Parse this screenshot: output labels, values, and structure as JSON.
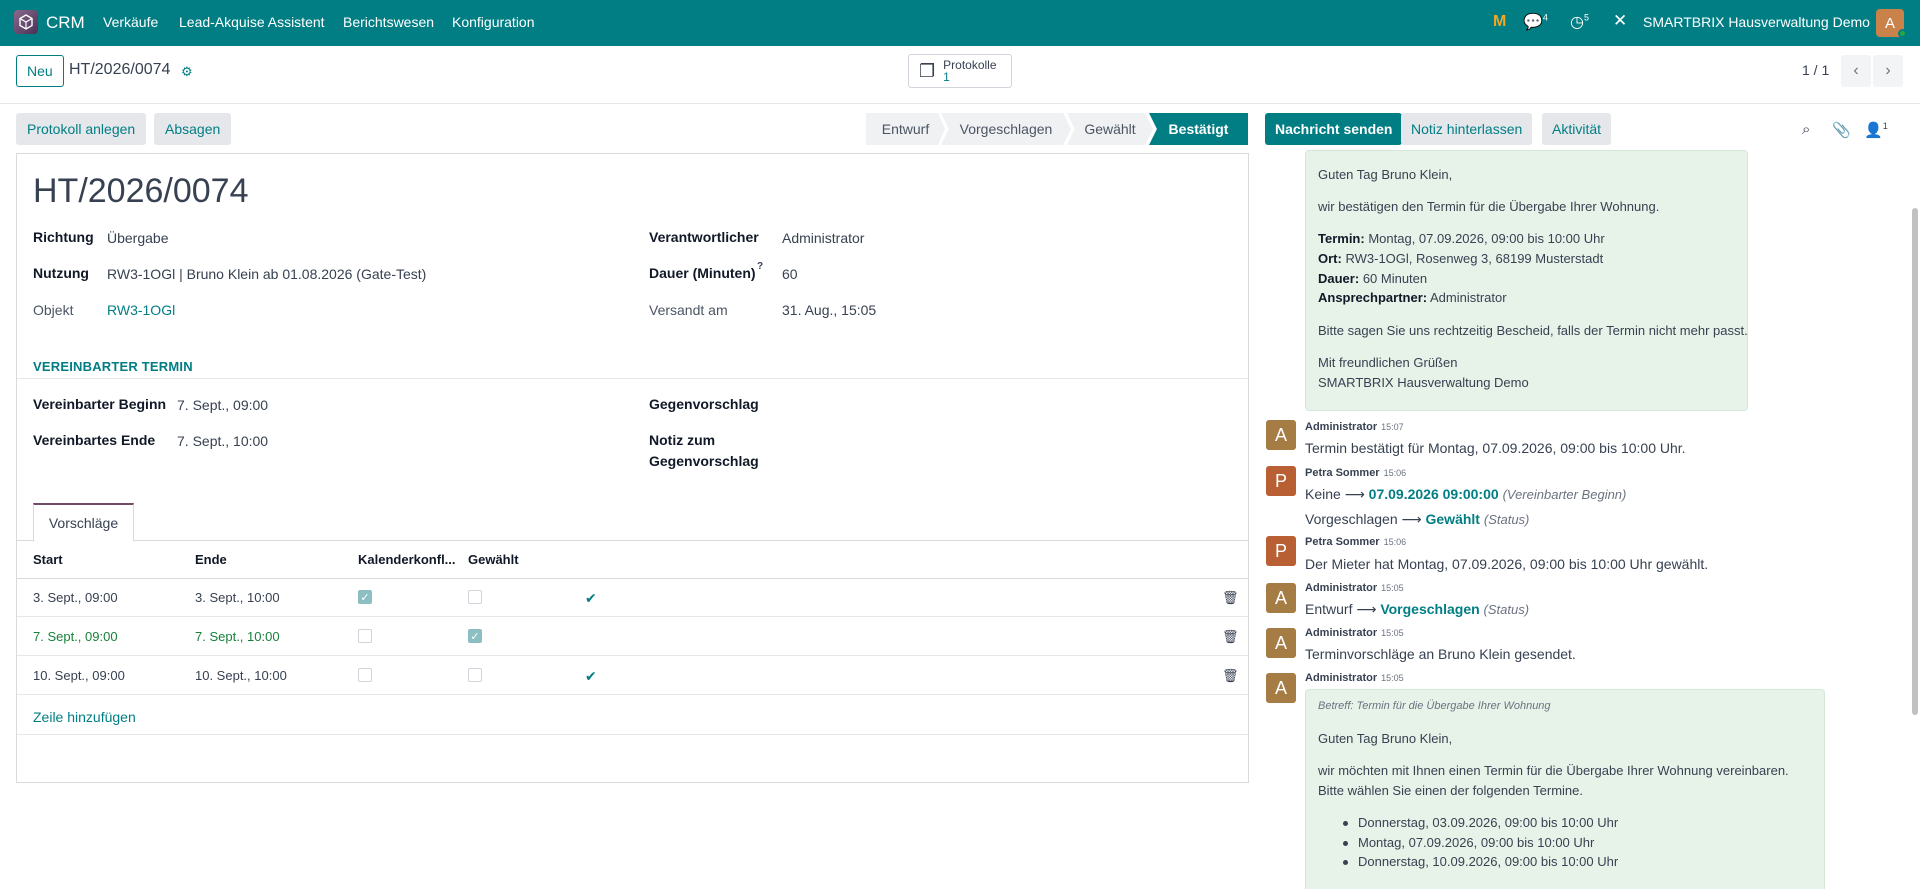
{
  "topbar": {
    "app_name": "CRM",
    "menu": [
      "Verkäufe",
      "Lead-Akquise Assistent",
      "Berichtswesen",
      "Konfiguration"
    ],
    "messages_count": "4",
    "activities_count": "5",
    "company": "SMARTBRIX Hausverwaltung Demo",
    "user_initial": "A"
  },
  "control": {
    "new_label": "Neu",
    "record_name": "HT/2026/0074",
    "smart_button_label": "Protokolle",
    "smart_button_count": "1",
    "pager": "1 / 1"
  },
  "statusbar": {
    "actions": [
      "Protokoll anlegen",
      "Absagen"
    ],
    "stages": [
      "Entwurf",
      "Vorgeschlagen",
      "Gewählt",
      "Bestätigt"
    ],
    "active_stage": "Bestätigt"
  },
  "form": {
    "title": "HT/2026/0074",
    "richtung_label": "Richtung",
    "richtung": "Übergabe",
    "nutzung_label": "Nutzung",
    "nutzung": "RW3-1OGl | Bruno Klein ab 01.08.2026 (Gate-Test)",
    "objekt_label": "Objekt",
    "objekt": "RW3-1OGl",
    "verantwortlicher_label": "Verantwortlicher",
    "verantwortlicher": "Administrator",
    "dauer_label": "Dauer (Minuten)",
    "dauer_help": "?",
    "dauer": "60",
    "versandt_label": "Versandt am",
    "versandt": "31. Aug., 15:05",
    "section_title": "VEREINBARTER TERMIN",
    "beginn_label": "Vereinbarter Beginn",
    "beginn": "7. Sept., 09:00",
    "ende_label": "Vereinbartes Ende",
    "ende": "7. Sept., 10:00",
    "gegenvorschlag_label": "Gegenvorschlag",
    "notiz_label_1": "Notiz zum",
    "notiz_label_2": "Gegenvorschlag"
  },
  "tab": {
    "label": "Vorschläge"
  },
  "table": {
    "headers": [
      "Start",
      "Ende",
      "Kalenderkonfl...",
      "Gewählt"
    ],
    "rows": [
      {
        "start": "3. Sept., 09:00",
        "ende": "3. Sept., 10:00",
        "konflikt": true,
        "gewaehlt": false,
        "ok": true
      },
      {
        "start": "7. Sept., 09:00",
        "ende": "7. Sept., 10:00",
        "konflikt": false,
        "gewaehlt": true,
        "ok": false
      },
      {
        "start": "10. Sept., 09:00",
        "ende": "10. Sept., 10:00",
        "konflikt": false,
        "gewaehlt": false,
        "ok": true
      }
    ],
    "add_line": "Zeile hinzufügen"
  },
  "chatter": {
    "send_message": "Nachricht senden",
    "log_note": "Notiz hinterlassen",
    "activity": "Aktivität",
    "followers_count": "1",
    "mail1": {
      "greeting": "Guten Tag Bruno Klein,",
      "intro": "wir bestätigen den Termin für die Übergabe Ihrer Wohnung.",
      "termin_label": "Termin:",
      "termin": "Montag, 07.09.2026, 09:00 bis 10:00 Uhr",
      "ort_label": "Ort:",
      "ort": "RW3-1OGl, Rosenweg 3, 68199 Musterstadt",
      "dauer_label": "Dauer:",
      "dauer": "60 Minuten",
      "ansprech_label": "Ansprechpartner:",
      "ansprech": "Administrator",
      "notice": "Bitte sagen Sie uns rechtzeitig Bescheid, falls der Termin nicht mehr passt.",
      "closing": "Mit freundlichen Grüßen",
      "signature": "SMARTBRIX Hausverwaltung Demo"
    },
    "messages": [
      {
        "author": "Administrator",
        "time": "15:07",
        "initial": "A",
        "color": "#a67c45",
        "text": "Termin bestätigt für Montag, 07.09.2026, 09:00 bis 10:00 Uhr."
      },
      {
        "author": "Petra Sommer",
        "time": "15:06",
        "initial": "P",
        "color": "#b86034",
        "change1_from": "Keine",
        "change1_to": "07.09.2026 09:00:00",
        "change1_field": "(Vereinbarter Beginn)",
        "change2_from": "Vorgeschlagen",
        "change2_to": "Gewählt",
        "change2_field": "(Status)"
      },
      {
        "author": "Petra Sommer",
        "time": "15:06",
        "initial": "P",
        "color": "#b86034",
        "text": "Der Mieter hat Montag, 07.09.2026, 09:00 bis 10:00 Uhr gewählt."
      },
      {
        "author": "Administrator",
        "time": "15:05",
        "initial": "A",
        "color": "#a67c45",
        "change_from": "Entwurf",
        "change_to": "Vorgeschlagen",
        "change_field": "(Status)"
      },
      {
        "author": "Administrator",
        "time": "15:05",
        "initial": "A",
        "color": "#a67c45",
        "text": "Terminvorschläge an Bruno Klein gesendet."
      },
      {
        "author": "Administrator",
        "time": "15:05",
        "initial": "A",
        "color": "#a67c45"
      }
    ],
    "mail2": {
      "subject": "Betreff: Termin für die Übergabe Ihrer Wohnung",
      "greeting": "Guten Tag Bruno Klein,",
      "line1": "wir möchten mit Ihnen einen Termin für die Übergabe Ihrer Wohnung vereinbaren.",
      "line2": "Bitte wählen Sie einen der folgenden Termine.",
      "options": [
        "Donnerstag, 03.09.2026, 09:00 bis 10:00 Uhr",
        "Montag, 07.09.2026, 09:00 bis 10:00 Uhr",
        "Donnerstag, 10.09.2026, 09:00 bis 10:00 Uhr"
      ]
    }
  }
}
